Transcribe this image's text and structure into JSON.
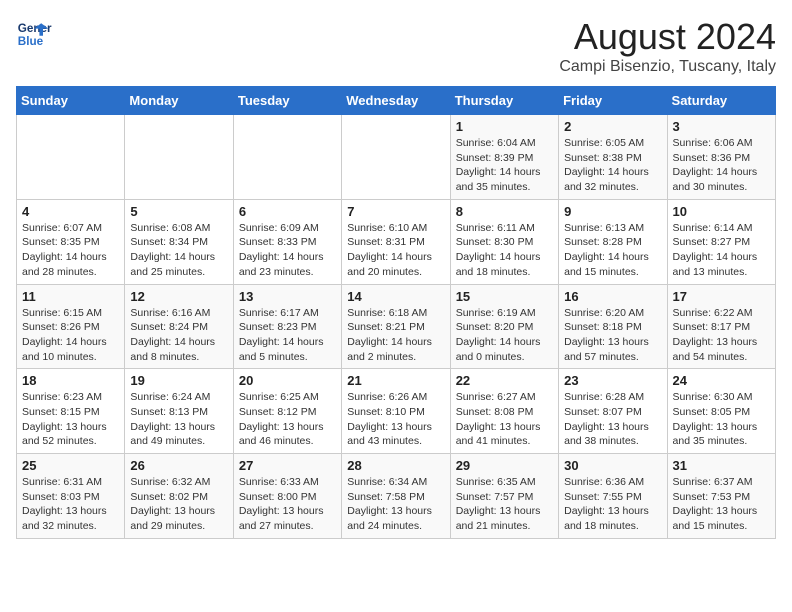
{
  "header": {
    "logo_line1": "General",
    "logo_line2": "Blue",
    "title": "August 2024",
    "subtitle": "Campi Bisenzio, Tuscany, Italy"
  },
  "days_of_week": [
    "Sunday",
    "Monday",
    "Tuesday",
    "Wednesday",
    "Thursday",
    "Friday",
    "Saturday"
  ],
  "weeks": [
    [
      {
        "day": "",
        "info": ""
      },
      {
        "day": "",
        "info": ""
      },
      {
        "day": "",
        "info": ""
      },
      {
        "day": "",
        "info": ""
      },
      {
        "day": "1",
        "info": "Sunrise: 6:04 AM\nSunset: 8:39 PM\nDaylight: 14 hours and 35 minutes."
      },
      {
        "day": "2",
        "info": "Sunrise: 6:05 AM\nSunset: 8:38 PM\nDaylight: 14 hours and 32 minutes."
      },
      {
        "day": "3",
        "info": "Sunrise: 6:06 AM\nSunset: 8:36 PM\nDaylight: 14 hours and 30 minutes."
      }
    ],
    [
      {
        "day": "4",
        "info": "Sunrise: 6:07 AM\nSunset: 8:35 PM\nDaylight: 14 hours and 28 minutes."
      },
      {
        "day": "5",
        "info": "Sunrise: 6:08 AM\nSunset: 8:34 PM\nDaylight: 14 hours and 25 minutes."
      },
      {
        "day": "6",
        "info": "Sunrise: 6:09 AM\nSunset: 8:33 PM\nDaylight: 14 hours and 23 minutes."
      },
      {
        "day": "7",
        "info": "Sunrise: 6:10 AM\nSunset: 8:31 PM\nDaylight: 14 hours and 20 minutes."
      },
      {
        "day": "8",
        "info": "Sunrise: 6:11 AM\nSunset: 8:30 PM\nDaylight: 14 hours and 18 minutes."
      },
      {
        "day": "9",
        "info": "Sunrise: 6:13 AM\nSunset: 8:28 PM\nDaylight: 14 hours and 15 minutes."
      },
      {
        "day": "10",
        "info": "Sunrise: 6:14 AM\nSunset: 8:27 PM\nDaylight: 14 hours and 13 minutes."
      }
    ],
    [
      {
        "day": "11",
        "info": "Sunrise: 6:15 AM\nSunset: 8:26 PM\nDaylight: 14 hours and 10 minutes."
      },
      {
        "day": "12",
        "info": "Sunrise: 6:16 AM\nSunset: 8:24 PM\nDaylight: 14 hours and 8 minutes."
      },
      {
        "day": "13",
        "info": "Sunrise: 6:17 AM\nSunset: 8:23 PM\nDaylight: 14 hours and 5 minutes."
      },
      {
        "day": "14",
        "info": "Sunrise: 6:18 AM\nSunset: 8:21 PM\nDaylight: 14 hours and 2 minutes."
      },
      {
        "day": "15",
        "info": "Sunrise: 6:19 AM\nSunset: 8:20 PM\nDaylight: 14 hours and 0 minutes."
      },
      {
        "day": "16",
        "info": "Sunrise: 6:20 AM\nSunset: 8:18 PM\nDaylight: 13 hours and 57 minutes."
      },
      {
        "day": "17",
        "info": "Sunrise: 6:22 AM\nSunset: 8:17 PM\nDaylight: 13 hours and 54 minutes."
      }
    ],
    [
      {
        "day": "18",
        "info": "Sunrise: 6:23 AM\nSunset: 8:15 PM\nDaylight: 13 hours and 52 minutes."
      },
      {
        "day": "19",
        "info": "Sunrise: 6:24 AM\nSunset: 8:13 PM\nDaylight: 13 hours and 49 minutes."
      },
      {
        "day": "20",
        "info": "Sunrise: 6:25 AM\nSunset: 8:12 PM\nDaylight: 13 hours and 46 minutes."
      },
      {
        "day": "21",
        "info": "Sunrise: 6:26 AM\nSunset: 8:10 PM\nDaylight: 13 hours and 43 minutes."
      },
      {
        "day": "22",
        "info": "Sunrise: 6:27 AM\nSunset: 8:08 PM\nDaylight: 13 hours and 41 minutes."
      },
      {
        "day": "23",
        "info": "Sunrise: 6:28 AM\nSunset: 8:07 PM\nDaylight: 13 hours and 38 minutes."
      },
      {
        "day": "24",
        "info": "Sunrise: 6:30 AM\nSunset: 8:05 PM\nDaylight: 13 hours and 35 minutes."
      }
    ],
    [
      {
        "day": "25",
        "info": "Sunrise: 6:31 AM\nSunset: 8:03 PM\nDaylight: 13 hours and 32 minutes."
      },
      {
        "day": "26",
        "info": "Sunrise: 6:32 AM\nSunset: 8:02 PM\nDaylight: 13 hours and 29 minutes."
      },
      {
        "day": "27",
        "info": "Sunrise: 6:33 AM\nSunset: 8:00 PM\nDaylight: 13 hours and 27 minutes."
      },
      {
        "day": "28",
        "info": "Sunrise: 6:34 AM\nSunset: 7:58 PM\nDaylight: 13 hours and 24 minutes."
      },
      {
        "day": "29",
        "info": "Sunrise: 6:35 AM\nSunset: 7:57 PM\nDaylight: 13 hours and 21 minutes."
      },
      {
        "day": "30",
        "info": "Sunrise: 6:36 AM\nSunset: 7:55 PM\nDaylight: 13 hours and 18 minutes."
      },
      {
        "day": "31",
        "info": "Sunrise: 6:37 AM\nSunset: 7:53 PM\nDaylight: 13 hours and 15 minutes."
      }
    ]
  ]
}
